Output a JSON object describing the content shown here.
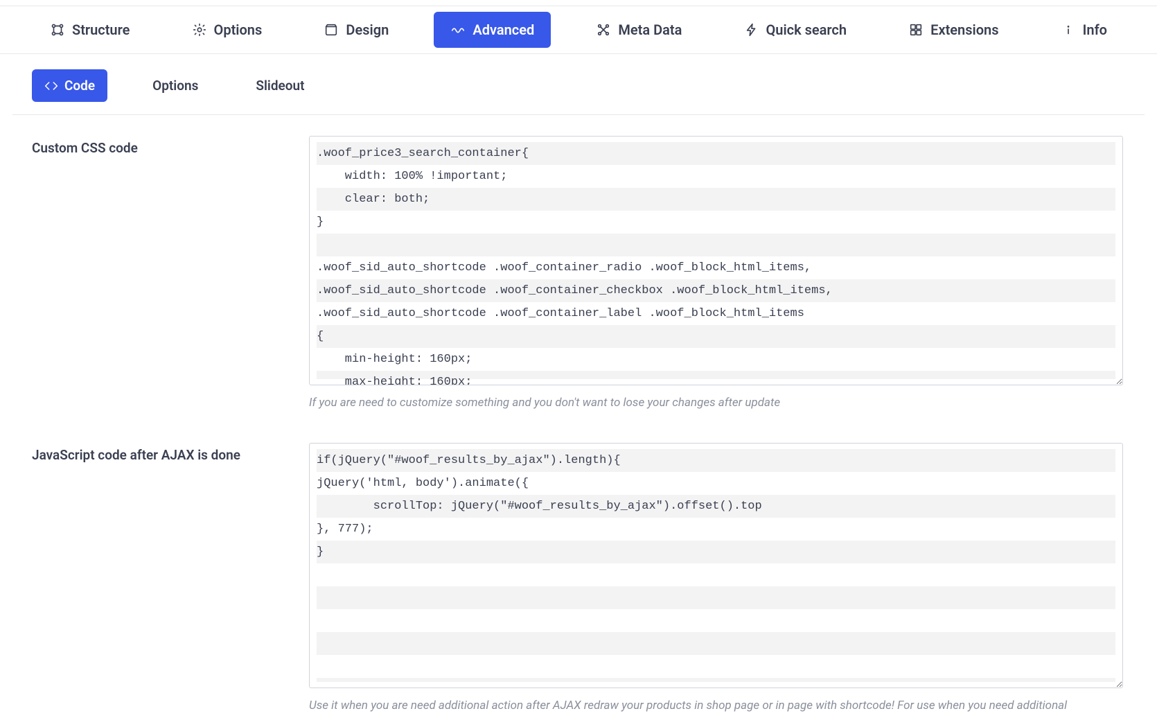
{
  "mainTabs": {
    "structure": "Structure",
    "options": "Options",
    "design": "Design",
    "advanced": "Advanced",
    "metaData": "Meta Data",
    "quickSearch": "Quick search",
    "extensions": "Extensions",
    "info": "Info"
  },
  "subTabs": {
    "code": "Code",
    "options": "Options",
    "slideout": "Slideout"
  },
  "fields": {
    "customCss": {
      "label": "Custom CSS code",
      "value": ".woof_price3_search_container{\n    width: 100% !important;\n    clear: both;\n}\n\n.woof_sid_auto_shortcode .woof_container_radio .woof_block_html_items,\n.woof_sid_auto_shortcode .woof_container_checkbox .woof_block_html_items,\n.woof_sid_auto_shortcode .woof_container_label .woof_block_html_items\n{\n    min-height: 160px;\n    max-height: 160px;",
      "hint": "If you are need to customize something and you don't want to lose your changes after update"
    },
    "jsAfterAjax": {
      "label": "JavaScript code after AJAX is done",
      "value": "if(jQuery(\"#woof_results_by_ajax\").length){\njQuery('html, body').animate({\n        scrollTop: jQuery(\"#woof_results_by_ajax\").offset().top\n}, 777);\n}",
      "hint": "Use it when you are need additional action after AJAX redraw your products in shop page or in page with shortcode! For use when you need additional"
    }
  }
}
